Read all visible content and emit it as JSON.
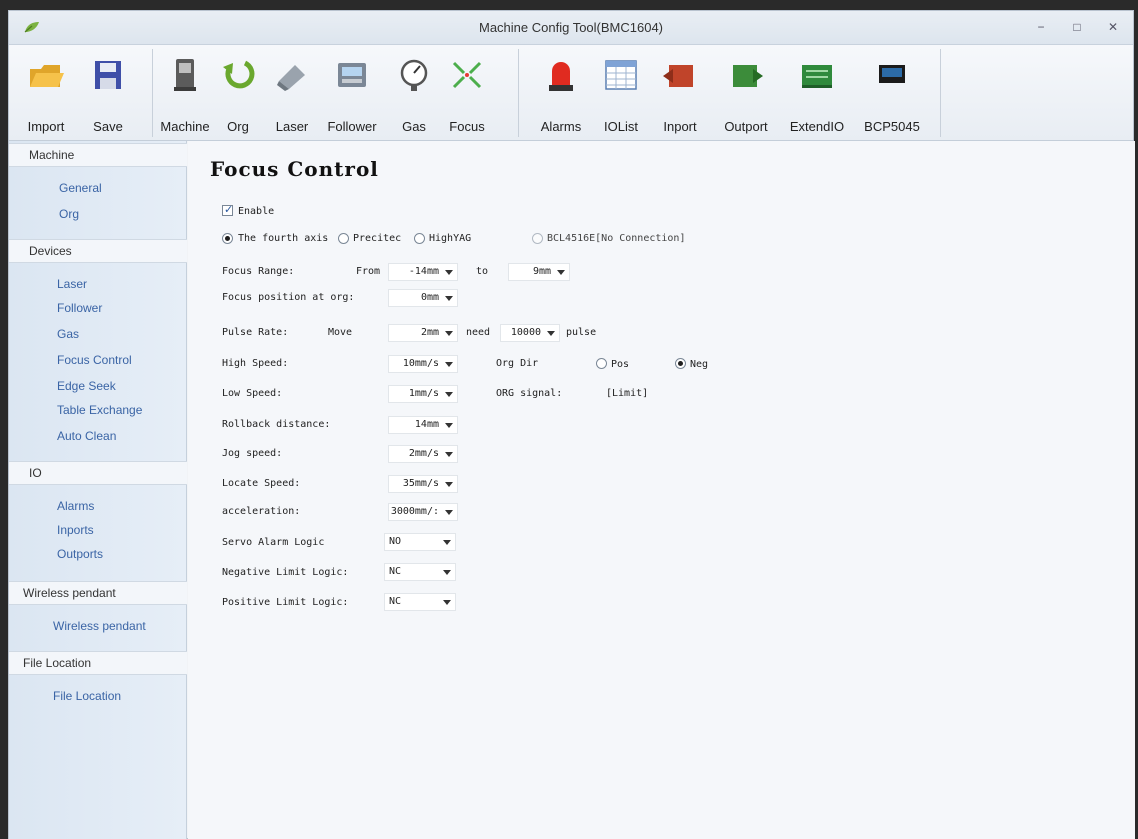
{
  "window": {
    "title": "Machine Config Tool(BMC1604)",
    "minimize": "−",
    "maximize": "□",
    "close": "✕"
  },
  "toolbar": {
    "items": [
      {
        "label": "Import",
        "icon": "folder-open-icon"
      },
      {
        "label": "Save",
        "icon": "floppy-disk-icon"
      },
      {
        "label": "Machine",
        "icon": "machine-icon"
      },
      {
        "label": "Org",
        "icon": "origin-arrow-icon"
      },
      {
        "label": "Laser",
        "icon": "laser-icon"
      },
      {
        "label": "Follower",
        "icon": "follower-icon"
      },
      {
        "label": "Gas",
        "icon": "gauge-icon"
      },
      {
        "label": "Focus",
        "icon": "focus-icon"
      },
      {
        "label": "Alarms",
        "icon": "alarm-light-icon"
      },
      {
        "label": "IOList",
        "icon": "table-icon"
      },
      {
        "label": "Inport",
        "icon": "inport-icon"
      },
      {
        "label": "Outport",
        "icon": "outport-icon"
      },
      {
        "label": "ExtendIO",
        "icon": "circuit-board-icon"
      },
      {
        "label": "BCP5045",
        "icon": "pendant-icon"
      }
    ]
  },
  "sidebar": {
    "sections": [
      {
        "title": "Machine",
        "items": [
          "General",
          "Org"
        ]
      },
      {
        "title": "Devices",
        "items": [
          "Laser",
          "Follower",
          "Gas",
          "Focus Control",
          "Edge Seek",
          "Table Exchange",
          "Auto Clean"
        ]
      },
      {
        "title": "IO",
        "items": [
          "Alarms",
          "Inports",
          "Outports"
        ]
      },
      {
        "title": "Wireless pendant",
        "items": [
          "Wireless pendant"
        ]
      },
      {
        "title": "File Location",
        "items": [
          "File Location"
        ]
      }
    ]
  },
  "focus": {
    "title": "Focus Control",
    "enable_label": "Enable",
    "enable_checked": true,
    "axis_options": [
      "The fourth axis",
      "Precitec",
      "HighYAG",
      "BCL4516E[No Connection]"
    ],
    "axis_selected": "The fourth axis",
    "focus_range_label": "Focus Range:",
    "from_label": "From",
    "from_value": "-14mm",
    "to_label": "to",
    "to_value": "9mm",
    "focus_org_label": "Focus position at org:",
    "focus_org_value": "0mm",
    "pulse_rate_label": "Pulse Rate:",
    "move_label": "Move",
    "move_value": "2mm",
    "need_label": "need",
    "need_value": "10000",
    "pulse_label": "pulse",
    "high_speed_label": "High Speed:",
    "high_speed_value": "10mm/s",
    "org_dir_label": "Org Dir",
    "org_dir_pos": "Pos",
    "org_dir_neg": "Neg",
    "org_dir_selected": "Neg",
    "low_speed_label": "Low Speed:",
    "low_speed_value": "1mm/s",
    "org_signal_label": "ORG signal:",
    "org_signal_value": "[Limit]",
    "rollback_label": "Rollback distance:",
    "rollback_value": "14mm",
    "jog_label": "Jog speed:",
    "jog_value": "2mm/s",
    "locate_label": "Locate Speed:",
    "locate_value": "35mm/s",
    "accel_label": "acceleration:",
    "accel_value": "3000mm/:",
    "servo_alarm_label": "Servo Alarm Logic",
    "servo_alarm_value": "NO",
    "neg_limit_label": "Negative Limit Logic:",
    "neg_limit_value": "NC",
    "pos_limit_label": "Positive Limit Logic:",
    "pos_limit_value": "NC"
  }
}
